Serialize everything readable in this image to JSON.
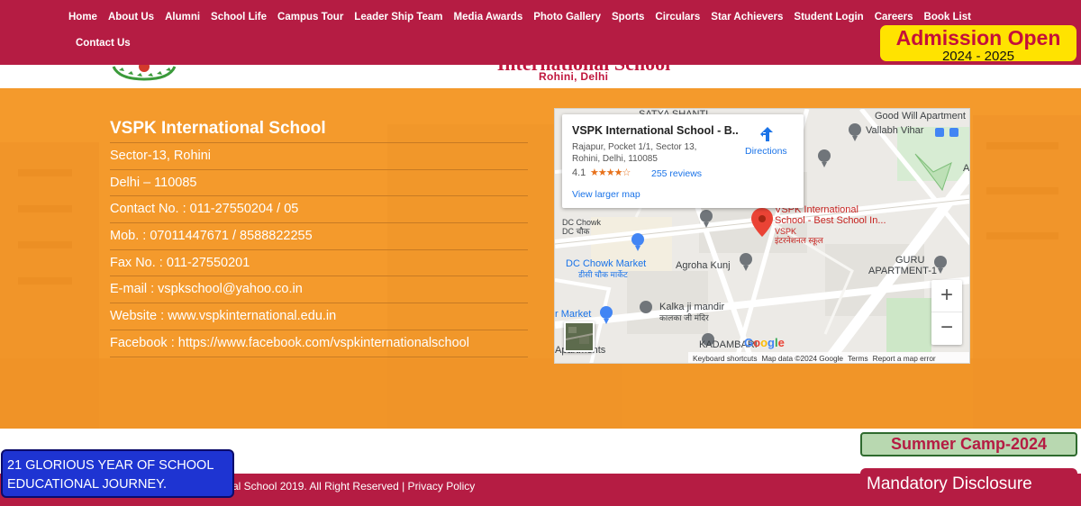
{
  "nav": {
    "items": [
      "Home",
      "About Us",
      "Alumni",
      "School Life",
      "Campus Tour",
      "Leader Ship Team",
      "Media Awards",
      "Photo Gallery",
      "Sports",
      "Circulars",
      "Star Achievers",
      "Student Login",
      "Careers",
      "Book List",
      "Contact Us"
    ]
  },
  "admission": {
    "line1": "Admission Open",
    "line2": "2024 - 2025"
  },
  "header": {
    "title_fragment": "International School",
    "subtitle": "Rohini, Delhi"
  },
  "contact": {
    "title": "VSPK International School",
    "lines": [
      "Sector-13, Rohini",
      "Delhi – 110085",
      "Contact No. : 011-27550204 / 05",
      "Mob. : 07011447671 / 8588822255",
      "Fax No. : 011-27550201",
      "E-mail : vspkschool@yahoo.co.in",
      "Website : www.vspkinternational.edu.in",
      "Facebook : https://www.facebook.com/vspkinternationalschool"
    ]
  },
  "map": {
    "card": {
      "name": "VSPK International School - B...",
      "address": "Rajapur, Pocket 1/1, Sector 13, Rohini, Delhi, 110085",
      "rating": "4.1",
      "stars": "★★★★☆",
      "reviews": "255 reviews",
      "view_larger": "View larger map",
      "directions": "Directions"
    },
    "labels": {
      "satya": "SATYA SHANTI",
      "goodwill": "Good Will Apartment",
      "vallabh": "Vallabh Vihar",
      "school_line1": "VSPK International",
      "school_line2": "School - Best School In...",
      "school_line3": "VSPK",
      "school_line4": "इंटरनेशनल स्कूल",
      "dc_chowk": "DC Chowk",
      "dc_chowk_hi": "DC चौक",
      "dc_market": "DC Chowk Market",
      "dc_market_hi": "डीसी चौक मार्केट",
      "agroha": "Agroha Kunj",
      "guru_line1": "GURU",
      "guru_line2": "APARTMENT-1",
      "kalka": "Kalka ji mandir",
      "kalka_hi": "कालका जी मंदिर",
      "market_fragment": "r Market",
      "apartments_fragment": "Apartments",
      "kadamba": "KADAMBARI",
      "edge_a": "A"
    },
    "zoom_in": "+",
    "zoom_out": "−",
    "google": [
      "G",
      "o",
      "o",
      "g",
      "l",
      "e"
    ],
    "footer": [
      "Keyboard shortcuts",
      "Map data ©2024 Google",
      "Terms",
      "Report a map error"
    ]
  },
  "summer_camp": "Summer Camp-2024",
  "mandatory": "Mandatory Disclosure",
  "copyright": "al School 2019. All Right Reserved | Privacy Policy",
  "glorious": {
    "line1": "21 GLORIOUS YEAR OF SCHOOL",
    "line2": "EDUCATIONAL JOURNEY."
  },
  "colors": {
    "primary": "#b51c43",
    "orange": "#f49a2c",
    "admission_bg": "#ffe300",
    "summer_bg": "#b8d8b0",
    "glorious_bg": "#1e34d2",
    "link": "#1a73e8"
  }
}
